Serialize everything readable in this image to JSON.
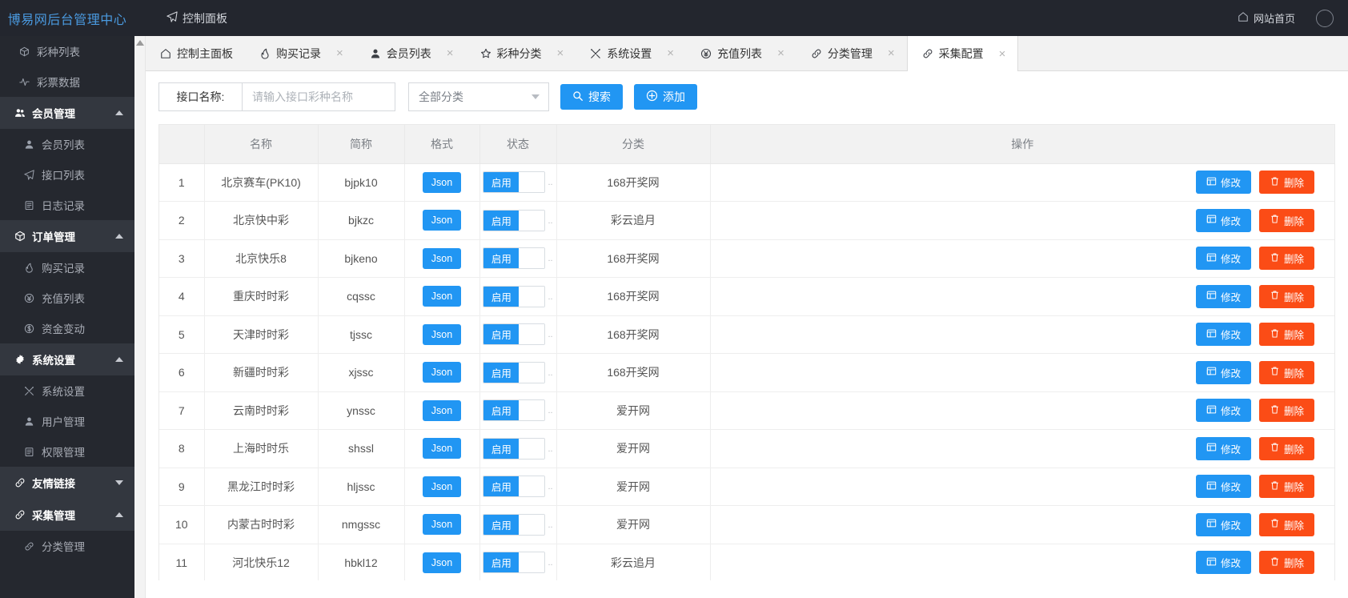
{
  "topbar": {
    "brand": "博易网后台管理中心",
    "nav": [
      {
        "icon": "paper-plane-icon",
        "label": "控制面板"
      }
    ],
    "right": [
      {
        "icon": "home-icon",
        "label": "网站首页"
      }
    ]
  },
  "sidebar": {
    "items": [
      {
        "icon": "cube-icon",
        "label": "彩种列表",
        "type": "plain"
      },
      {
        "icon": "pulse-icon",
        "label": "彩票数据",
        "type": "plain"
      },
      {
        "icon": "users-icon",
        "label": "会员管理",
        "type": "group",
        "caret": "up"
      },
      {
        "icon": "user-icon",
        "label": "会员列表",
        "type": "sub"
      },
      {
        "icon": "paper-plane-icon",
        "label": "接口列表",
        "type": "sub"
      },
      {
        "icon": "clipboard-icon",
        "label": "日志记录",
        "type": "sub"
      },
      {
        "icon": "cube-icon",
        "label": "订单管理",
        "type": "group",
        "caret": "up"
      },
      {
        "icon": "fire-icon",
        "label": "购买记录",
        "type": "sub"
      },
      {
        "icon": "yen-icon",
        "label": "充值列表",
        "type": "sub"
      },
      {
        "icon": "dollar-icon",
        "label": "资金变动",
        "type": "sub"
      },
      {
        "icon": "gear-icon",
        "label": "系统设置",
        "type": "group",
        "caret": "up"
      },
      {
        "icon": "tools-icon",
        "label": "系统设置",
        "type": "sub"
      },
      {
        "icon": "user-icon",
        "label": "用户管理",
        "type": "sub"
      },
      {
        "icon": "clipboard-icon",
        "label": "权限管理",
        "type": "sub"
      },
      {
        "icon": "link-icon",
        "label": "友情链接",
        "type": "group",
        "caret": "down"
      },
      {
        "icon": "link-icon",
        "label": "采集管理",
        "type": "group",
        "caret": "up"
      },
      {
        "icon": "link-icon",
        "label": "分类管理",
        "type": "sub"
      }
    ]
  },
  "tabs": [
    {
      "icon": "home-icon",
      "label": "控制主面板",
      "closable": false,
      "active": false
    },
    {
      "icon": "fire-icon",
      "label": "购买记录",
      "closable": true,
      "active": false
    },
    {
      "icon": "user-icon",
      "label": "会员列表",
      "closable": true,
      "active": false
    },
    {
      "icon": "star-icon",
      "label": "彩种分类",
      "closable": true,
      "active": false
    },
    {
      "icon": "tools-icon",
      "label": "系统设置",
      "closable": true,
      "active": false
    },
    {
      "icon": "yen-icon",
      "label": "充值列表",
      "closable": true,
      "active": false
    },
    {
      "icon": "link-icon",
      "label": "分类管理",
      "closable": true,
      "active": false
    },
    {
      "icon": "link-icon",
      "label": "采集配置",
      "closable": true,
      "active": true
    }
  ],
  "filter": {
    "label": "接口名称:",
    "input_value": "",
    "input_placeholder": "请输入接口彩种名称",
    "category_selected": "全部分类",
    "search_label": "搜索",
    "search_icon": "search-icon",
    "add_label": "添加",
    "add_icon": "plus-circle-icon"
  },
  "table": {
    "columns": [
      "",
      "名称",
      "简称",
      "格式",
      "状态",
      "分类",
      "操作"
    ],
    "edit_label": "修改",
    "delete_label": "删除",
    "edit_icon": "window-icon",
    "delete_icon": "trash-icon",
    "switch_on_label": "启用",
    "rows": [
      {
        "idx": "1",
        "name": "北京赛车(PK10)",
        "short": "bjpk10",
        "format": "Json",
        "status": "启用",
        "category": "168开奖网"
      },
      {
        "idx": "2",
        "name": "北京快中彩",
        "short": "bjkzc",
        "format": "Json",
        "status": "启用",
        "category": "彩云追月"
      },
      {
        "idx": "3",
        "name": "北京快乐8",
        "short": "bjkeno",
        "format": "Json",
        "status": "启用",
        "category": "168开奖网"
      },
      {
        "idx": "4",
        "name": "重庆时时彩",
        "short": "cqssc",
        "format": "Json",
        "status": "启用",
        "category": "168开奖网"
      },
      {
        "idx": "5",
        "name": "天津时时彩",
        "short": "tjssc",
        "format": "Json",
        "status": "启用",
        "category": "168开奖网"
      },
      {
        "idx": "6",
        "name": "新疆时时彩",
        "short": "xjssc",
        "format": "Json",
        "status": "启用",
        "category": "168开奖网"
      },
      {
        "idx": "7",
        "name": "云南时时彩",
        "short": "ynssc",
        "format": "Json",
        "status": "启用",
        "category": "爱开网"
      },
      {
        "idx": "8",
        "name": "上海时时乐",
        "short": "shssl",
        "format": "Json",
        "status": "启用",
        "category": "爱开网"
      },
      {
        "idx": "9",
        "name": "黑龙江时时彩",
        "short": "hljssc",
        "format": "Json",
        "status": "启用",
        "category": "爱开网"
      },
      {
        "idx": "10",
        "name": "内蒙古时时彩",
        "short": "nmgssc",
        "format": "Json",
        "status": "启用",
        "category": "爱开网"
      },
      {
        "idx": "11",
        "name": "河北快乐12",
        "short": "hbkl12",
        "format": "Json",
        "status": "启用",
        "category": "彩云追月"
      }
    ]
  },
  "colors": {
    "brand_blue": "#4a9ae0",
    "primary": "#2196f3",
    "danger": "#fb4c16",
    "sidebar_bg": "#25282f",
    "sidebar_group_bg": "#33373f",
    "topbar_bg": "#23262e"
  }
}
